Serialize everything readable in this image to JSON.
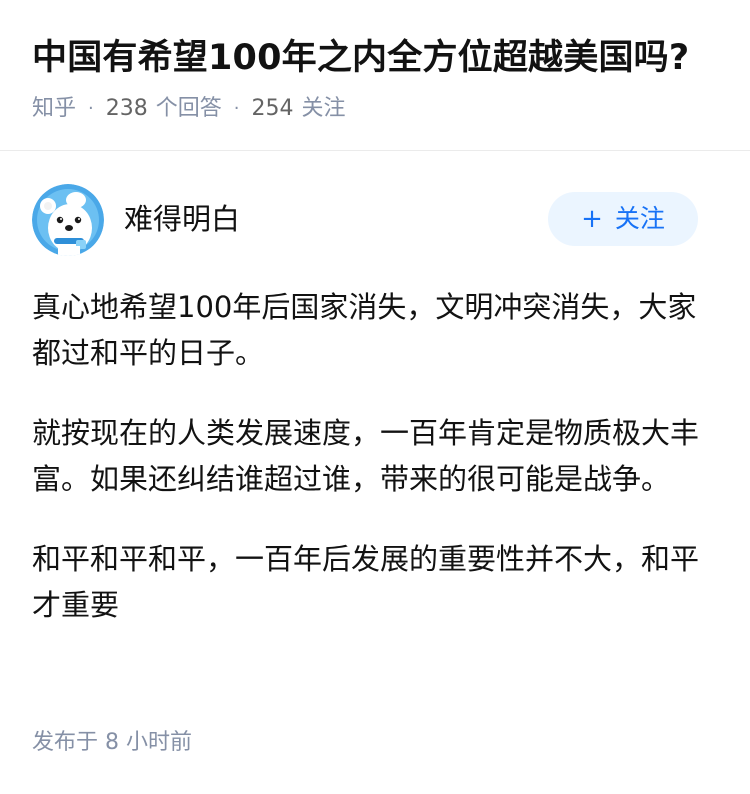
{
  "question": {
    "title": "中国有希望100年之内全方位超越美国吗?",
    "source": "知乎",
    "separator": "·",
    "answer_count": "238",
    "answer_label": "个回答",
    "follower_count": "254",
    "follower_label": "关注"
  },
  "author": {
    "name": "难得明白",
    "avatar_icon": "cartoon-bear-avatar-icon",
    "follow_button": {
      "icon": "plus-icon",
      "plus": "+",
      "label": "关注"
    }
  },
  "answer": {
    "paragraphs": [
      "真心地希望100年后国家消失，文明冲突消失，大家都过和平的日子。",
      "就按现在的人类发展速度，一百年肯定是物质极大丰富。如果还纠结谁超过谁，带来的很可能是战争。",
      "和平和平和平，一百年后发展的重要性并不大，和平才重要"
    ]
  },
  "publish": {
    "label": "发布于",
    "time": "8 小时前"
  },
  "colors": {
    "title_text": "#121212",
    "meta_text": "#8590a6",
    "follow_bg": "#ebf5ff",
    "follow_text": "#1772f6",
    "avatar_bg": "#4aa8e8",
    "divider": "#ebebeb"
  }
}
